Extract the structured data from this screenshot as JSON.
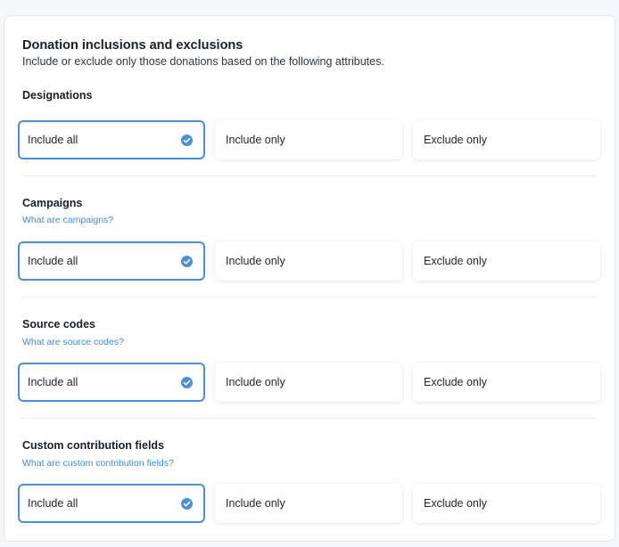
{
  "header": {
    "title": "Donation inclusions and exclusions",
    "subtitle": "Include or exclude only those donations based on the following attributes."
  },
  "options": [
    "Include all",
    "Include only",
    "Exclude only"
  ],
  "sections": [
    {
      "title": "Designations",
      "link": "",
      "selected": "Include all"
    },
    {
      "title": "Campaigns",
      "link": "What are campaigns?",
      "selected": "Include all"
    },
    {
      "title": "Source codes",
      "link": "What are source codes?",
      "selected": "Include all"
    },
    {
      "title": "Custom contribution fields",
      "link": "What are custom contribution fields?",
      "selected": "Include all"
    }
  ],
  "colors": {
    "accent": "#4a90d9",
    "link": "#3f8bd6"
  },
  "icons": {
    "selected": "check-circle-icon"
  }
}
